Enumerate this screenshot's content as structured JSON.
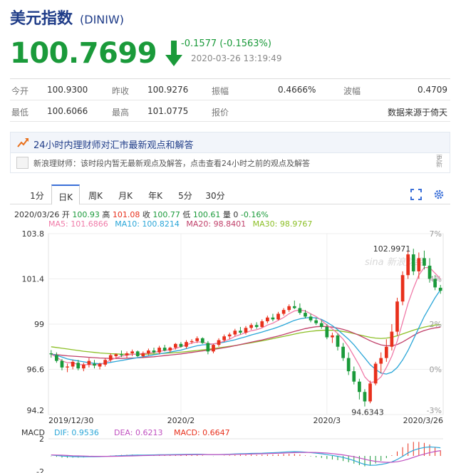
{
  "header": {
    "title": "美元指数",
    "code": "(DINIW)"
  },
  "quote": {
    "price": "100.7699",
    "change": "-0.1577 (-0.1563%)",
    "timestamp": "2020-03-26 13:19:49"
  },
  "stats": {
    "row1": {
      "open_label": "今开",
      "open": "100.9300",
      "prev_label": "昨收",
      "prev": "100.9276",
      "amp_label": "振幅",
      "amp": "0.4666%",
      "wave_label": "波幅",
      "wave": "0.4709"
    },
    "row2": {
      "low_label": "最低",
      "low": "100.6066",
      "high_label": "最高",
      "high": "101.0775",
      "quote_label": "报价",
      "source": "数据来源于倚天"
    }
  },
  "insight": {
    "text": "24小时内理财师对汇市最新观点和解答"
  },
  "advisor": {
    "text": "新浪理财师：该时段内暂无最新观点及解答，点击查看24小时之前的观点及解答",
    "update_top": "更",
    "update_bottom": "新"
  },
  "tabs": [
    "1分",
    "日K",
    "周K",
    "月K",
    "年K",
    "5分",
    "30分"
  ],
  "ohlc": {
    "date": "2020/03/26",
    "open_label": "开",
    "open": "100.93",
    "high_label": "高",
    "high": "101.08",
    "close_label": "收",
    "close": "100.77",
    "low_label": "低",
    "low": "100.61",
    "vol_label": "量",
    "vol": "0",
    "chg": "-0.16%"
  },
  "ma": {
    "ma5": "MA5: 101.6866",
    "ma10": "MA10: 100.8214",
    "ma20": "MA20: 98.8401",
    "ma30": "MA30: 98.9767"
  },
  "macd": {
    "label": "MACD",
    "dif": "DIF: 0.9536",
    "dea": "DEA: 0.6213",
    "macd": "MACD: 0.6647"
  },
  "colors": {
    "up": "#e8301c",
    "down": "#1a9a3a",
    "ma5": "#f07aa8",
    "ma10": "#2aa6d8",
    "ma20": "#c0406a",
    "ma30": "#8cbf26"
  },
  "chart_data": {
    "type": "candlestick",
    "ylim": [
      94.2,
      103.8
    ],
    "y_ticks": [
      "103.8",
      "101.4",
      "99",
      "96.6",
      "94.2"
    ],
    "pct_ticks": [
      "7%",
      "4%",
      "2%",
      "0%",
      "-3%"
    ],
    "x_ticks": [
      "2019/12/30",
      "2020/2",
      "2020/3",
      "2020/3/26"
    ],
    "annotations": {
      "max": "102.9971",
      "min": "94.6343"
    },
    "watermark": "sina 新浪财经",
    "macd_ticks": [
      "2",
      "-2"
    ],
    "candles": [
      [
        97.45,
        97.62,
        97.22,
        97.4
      ],
      [
        97.35,
        97.5,
        96.95,
        97.05
      ],
      [
        97.05,
        97.15,
        96.55,
        96.7
      ],
      [
        96.7,
        96.9,
        96.45,
        96.75
      ],
      [
        96.75,
        97.1,
        96.6,
        97.0
      ],
      [
        96.95,
        97.1,
        96.55,
        96.65
      ],
      [
        96.65,
        96.95,
        96.5,
        96.85
      ],
      [
        96.85,
        97.2,
        96.7,
        97.05
      ],
      [
        96.9,
        97.1,
        96.65,
        96.8
      ],
      [
        96.75,
        96.95,
        96.6,
        96.9
      ],
      [
        96.85,
        97.2,
        96.75,
        97.1
      ],
      [
        97.1,
        97.45,
        97.0,
        97.35
      ],
      [
        97.3,
        97.45,
        97.15,
        97.4
      ],
      [
        97.4,
        97.6,
        97.25,
        97.35
      ],
      [
        97.35,
        97.55,
        97.2,
        97.45
      ],
      [
        97.45,
        97.65,
        97.3,
        97.55
      ],
      [
        97.55,
        97.6,
        97.25,
        97.3
      ],
      [
        97.3,
        97.55,
        97.2,
        97.45
      ],
      [
        97.45,
        97.7,
        97.35,
        97.6
      ],
      [
        97.6,
        97.75,
        97.45,
        97.5
      ],
      [
        97.5,
        97.85,
        97.4,
        97.75
      ],
      [
        97.75,
        97.9,
        97.55,
        97.6
      ],
      [
        97.6,
        97.8,
        97.5,
        97.75
      ],
      [
        97.75,
        98.0,
        97.65,
        97.95
      ],
      [
        97.95,
        98.05,
        97.75,
        97.8
      ],
      [
        97.8,
        98.15,
        97.7,
        98.05
      ],
      [
        98.05,
        98.2,
        97.95,
        98.1
      ],
      [
        98.1,
        98.35,
        98.0,
        98.25
      ],
      [
        98.25,
        98.3,
        97.95,
        98.0
      ],
      [
        98.0,
        98.1,
        97.4,
        97.55
      ],
      [
        97.55,
        97.95,
        97.45,
        97.9
      ],
      [
        97.9,
        98.25,
        97.8,
        98.15
      ],
      [
        98.15,
        98.45,
        98.05,
        98.35
      ],
      [
        98.35,
        98.55,
        98.2,
        98.45
      ],
      [
        98.45,
        98.75,
        98.35,
        98.65
      ],
      [
        98.65,
        98.85,
        98.45,
        98.55
      ],
      [
        98.55,
        98.9,
        98.45,
        98.8
      ],
      [
        98.8,
        99.05,
        98.7,
        98.95
      ],
      [
        98.95,
        99.1,
        98.75,
        98.85
      ],
      [
        98.85,
        99.25,
        98.8,
        99.15
      ],
      [
        99.15,
        99.45,
        99.05,
        99.35
      ],
      [
        99.35,
        99.55,
        99.15,
        99.25
      ],
      [
        99.25,
        99.65,
        99.2,
        99.55
      ],
      [
        99.55,
        99.85,
        99.45,
        99.75
      ],
      [
        99.75,
        100.05,
        99.65,
        99.95
      ],
      [
        99.95,
        100.25,
        99.8,
        99.85
      ],
      [
        99.85,
        100.1,
        99.5,
        99.6
      ],
      [
        99.6,
        99.75,
        99.3,
        99.4
      ],
      [
        99.4,
        99.55,
        99.1,
        99.2
      ],
      [
        99.2,
        99.35,
        98.95,
        99.05
      ],
      [
        99.05,
        99.2,
        98.75,
        98.85
      ],
      [
        98.85,
        99.0,
        98.2,
        98.3
      ],
      [
        98.3,
        98.55,
        98.0,
        98.4
      ],
      [
        98.4,
        98.5,
        97.6,
        97.8
      ],
      [
        97.8,
        98.0,
        97.05,
        97.2
      ],
      [
        97.2,
        97.5,
        96.3,
        96.5
      ],
      [
        96.5,
        96.75,
        95.8,
        95.95
      ],
      [
        95.95,
        96.1,
        95.0,
        95.4
      ],
      [
        95.4,
        95.55,
        94.63,
        94.9
      ],
      [
        94.9,
        96.0,
        94.8,
        95.85
      ],
      [
        95.85,
        97.0,
        95.75,
        96.9
      ],
      [
        96.9,
        97.5,
        96.4,
        97.2
      ],
      [
        97.2,
        98.2,
        97.0,
        97.8
      ],
      [
        97.8,
        99.0,
        97.6,
        98.6
      ],
      [
        98.6,
        100.4,
        98.4,
        100.2
      ],
      [
        100.2,
        101.8,
        100.0,
        101.6
      ],
      [
        101.6,
        102.9,
        101.4,
        102.7
      ],
      [
        102.7,
        103.0,
        101.6,
        101.8
      ],
      [
        101.8,
        102.8,
        101.4,
        102.5
      ],
      [
        102.5,
        102.9,
        101.9,
        102.1
      ],
      [
        102.1,
        102.5,
        101.2,
        101.4
      ],
      [
        101.4,
        101.6,
        100.8,
        100.95
      ],
      [
        100.93,
        101.08,
        100.61,
        100.77
      ]
    ],
    "series": [
      {
        "name": "MA5",
        "values": [
          97.4,
          97.25,
          97.05,
          96.95,
          96.95,
          96.85,
          96.85,
          96.85,
          96.85,
          96.85,
          96.95,
          97.1,
          97.2,
          97.3,
          97.35,
          97.4,
          97.4,
          97.45,
          97.45,
          97.5,
          97.55,
          97.6,
          97.65,
          97.7,
          97.8,
          97.9,
          98.0,
          98.05,
          98.05,
          97.95,
          97.95,
          98.0,
          98.1,
          98.2,
          98.35,
          98.45,
          98.55,
          98.65,
          98.7,
          98.8,
          98.95,
          99.05,
          99.2,
          99.35,
          99.55,
          99.7,
          99.75,
          99.7,
          99.55,
          99.4,
          99.2,
          98.95,
          98.75,
          98.5,
          98.2,
          97.8,
          97.3,
          96.8,
          96.2,
          95.9,
          95.95,
          96.2,
          96.7,
          97.3,
          98.1,
          99.1,
          100.1,
          100.9,
          101.6,
          102.0,
          102.0,
          101.7,
          101.4
        ]
      },
      {
        "name": "MA10",
        "values": [
          97.4,
          97.35,
          97.25,
          97.15,
          97.1,
          97.05,
          97.0,
          96.95,
          96.92,
          96.9,
          96.92,
          96.97,
          97.02,
          97.07,
          97.12,
          97.17,
          97.22,
          97.27,
          97.32,
          97.37,
          97.42,
          97.47,
          97.52,
          97.57,
          97.62,
          97.7,
          97.78,
          97.85,
          97.9,
          97.92,
          97.95,
          97.99,
          98.04,
          98.1,
          98.17,
          98.25,
          98.33,
          98.42,
          98.5,
          98.58,
          98.67,
          98.75,
          98.85,
          98.96,
          99.08,
          99.2,
          99.28,
          99.33,
          99.35,
          99.33,
          99.25,
          99.1,
          98.92,
          98.7,
          98.45,
          98.2,
          97.9,
          97.55,
          97.2,
          96.85,
          96.6,
          96.4,
          96.35,
          96.45,
          96.7,
          97.1,
          97.6,
          98.2,
          98.8,
          99.4,
          99.9,
          100.4,
          100.82
        ]
      },
      {
        "name": "MA20",
        "values": [
          97.4,
          97.38,
          97.35,
          97.32,
          97.3,
          97.28,
          97.26,
          97.24,
          97.22,
          97.2,
          97.19,
          97.18,
          97.18,
          97.18,
          97.19,
          97.2,
          97.21,
          97.23,
          97.25,
          97.27,
          97.3,
          97.33,
          97.36,
          97.39,
          97.42,
          97.46,
          97.5,
          97.54,
          97.58,
          97.62,
          97.66,
          97.7,
          97.75,
          97.8,
          97.86,
          97.92,
          97.98,
          98.04,
          98.1,
          98.16,
          98.23,
          98.3,
          98.37,
          98.45,
          98.53,
          98.61,
          98.69,
          98.76,
          98.82,
          98.86,
          98.88,
          98.87,
          98.84,
          98.79,
          98.72,
          98.63,
          98.52,
          98.4,
          98.26,
          98.12,
          98.0,
          97.9,
          97.85,
          97.85,
          97.92,
          98.05,
          98.22,
          98.4,
          98.55,
          98.66,
          98.74,
          98.8,
          98.84
        ]
      },
      {
        "name": "MA30",
        "values": [
          97.8,
          97.76,
          97.72,
          97.68,
          97.64,
          97.6,
          97.56,
          97.53,
          97.5,
          97.47,
          97.45,
          97.43,
          97.42,
          97.41,
          97.4,
          97.4,
          97.4,
          97.4,
          97.41,
          97.42,
          97.43,
          97.45,
          97.47,
          97.49,
          97.51,
          97.54,
          97.57,
          97.6,
          97.63,
          97.66,
          97.7,
          97.74,
          97.78,
          97.82,
          97.86,
          97.91,
          97.96,
          98.01,
          98.06,
          98.11,
          98.17,
          98.23,
          98.29,
          98.35,
          98.41,
          98.47,
          98.53,
          98.58,
          98.62,
          98.65,
          98.67,
          98.68,
          98.67,
          98.65,
          98.61,
          98.56,
          98.5,
          98.43,
          98.36,
          98.3,
          98.26,
          98.24,
          98.26,
          98.3,
          98.38,
          98.48,
          98.58,
          98.68,
          98.76,
          98.84,
          98.9,
          98.95,
          98.98
        ]
      }
    ],
    "macd_dif": [
      0.1,
      0.05,
      -0.02,
      -0.06,
      -0.08,
      -0.1,
      -0.11,
      -0.1,
      -0.09,
      -0.08,
      -0.06,
      -0.03,
      0.0,
      0.03,
      0.06,
      0.08,
      0.09,
      0.1,
      0.11,
      0.12,
      0.13,
      0.14,
      0.15,
      0.16,
      0.17,
      0.18,
      0.19,
      0.2,
      0.19,
      0.16,
      0.15,
      0.16,
      0.18,
      0.2,
      0.23,
      0.25,
      0.27,
      0.29,
      0.3,
      0.32,
      0.35,
      0.37,
      0.4,
      0.44,
      0.48,
      0.5,
      0.48,
      0.44,
      0.38,
      0.32,
      0.25,
      0.15,
      0.06,
      -0.05,
      -0.18,
      -0.35,
      -0.55,
      -0.78,
      -1.0,
      -1.1,
      -1.08,
      -1.0,
      -0.88,
      -0.7,
      -0.42,
      -0.05,
      0.35,
      0.65,
      0.85,
      0.98,
      1.05,
      1.02,
      0.95
    ],
    "macd_dea": [
      0.12,
      0.1,
      0.08,
      0.05,
      0.02,
      0.0,
      -0.02,
      -0.04,
      -0.05,
      -0.05,
      -0.05,
      -0.05,
      -0.04,
      -0.03,
      -0.01,
      0.0,
      0.02,
      0.04,
      0.05,
      0.07,
      0.08,
      0.09,
      0.1,
      0.11,
      0.12,
      0.13,
      0.14,
      0.15,
      0.16,
      0.16,
      0.16,
      0.16,
      0.16,
      0.17,
      0.18,
      0.19,
      0.21,
      0.22,
      0.24,
      0.25,
      0.27,
      0.29,
      0.31,
      0.33,
      0.36,
      0.38,
      0.4,
      0.41,
      0.41,
      0.4,
      0.37,
      0.33,
      0.27,
      0.2,
      0.12,
      0.02,
      -0.1,
      -0.24,
      -0.39,
      -0.53,
      -0.64,
      -0.71,
      -0.75,
      -0.74,
      -0.68,
      -0.56,
      -0.38,
      -0.17,
      0.03,
      0.22,
      0.38,
      0.51,
      0.62
    ]
  }
}
